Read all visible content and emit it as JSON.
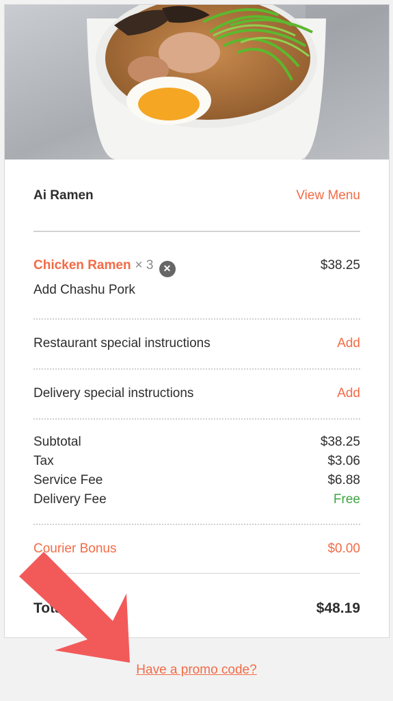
{
  "restaurant": {
    "name": "Ai Ramen",
    "view_menu_label": "View Menu"
  },
  "item": {
    "name": "Chicken Ramen",
    "quantity": "× 3",
    "price": "$38.25",
    "modifier": "Add Chashu Pork"
  },
  "instructions": {
    "restaurant_label": "Restaurant special instructions",
    "restaurant_action": "Add",
    "delivery_label": "Delivery special instructions",
    "delivery_action": "Add"
  },
  "summary": {
    "subtotal_label": "Subtotal",
    "subtotal_value": "$38.25",
    "tax_label": "Tax",
    "tax_value": "$3.06",
    "service_fee_label": "Service Fee",
    "service_fee_value": "$6.88",
    "delivery_fee_label": "Delivery Fee",
    "delivery_fee_value": "Free"
  },
  "courier": {
    "label": "Courier Bonus",
    "value": "$0.00"
  },
  "total": {
    "label": "Total",
    "value": "$48.19"
  },
  "promo": {
    "label": "Have a promo code?"
  },
  "colors": {
    "accent": "#f26b46",
    "free": "#3fa543",
    "annotation_arrow": "#f25a5a"
  },
  "icons": {
    "remove": "close-circle-icon",
    "annotation": "arrow-annotation"
  }
}
